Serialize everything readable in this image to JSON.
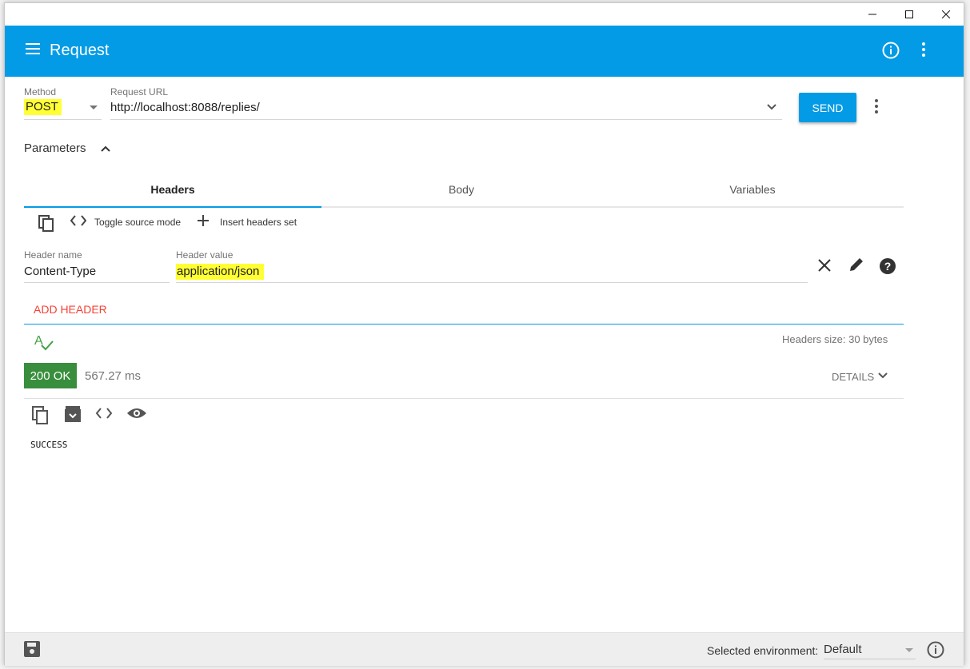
{
  "appbar": {
    "title": "Request",
    "bg_color": "#039be5"
  },
  "request": {
    "method_label": "Method",
    "method_value": "POST",
    "url_label": "Request URL",
    "url_value": "http://localhost:8088/replies/",
    "send_label": "SEND"
  },
  "parameters": {
    "label": "Parameters"
  },
  "tabs": [
    {
      "label": "Headers",
      "active": true
    },
    {
      "label": "Body",
      "active": false
    },
    {
      "label": "Variables",
      "active": false
    }
  ],
  "headers_toolbar": {
    "toggle_label": "Toggle source mode",
    "insert_label": "Insert headers set"
  },
  "header_row": {
    "name_label": "Header name",
    "name_value": "Content-Type",
    "value_label": "Header value",
    "value_value": "application/json"
  },
  "add_header_label": "ADD HEADER",
  "headers_size": "Headers size: 30 bytes",
  "response": {
    "status": "200 OK",
    "status_color": "#388e3c",
    "time": "567.27 ms",
    "details_label": "DETAILS",
    "body": "SUCCESS"
  },
  "footer": {
    "env_label": "Selected environment:",
    "env_value": "Default"
  },
  "highlight_color": "#ffff33"
}
